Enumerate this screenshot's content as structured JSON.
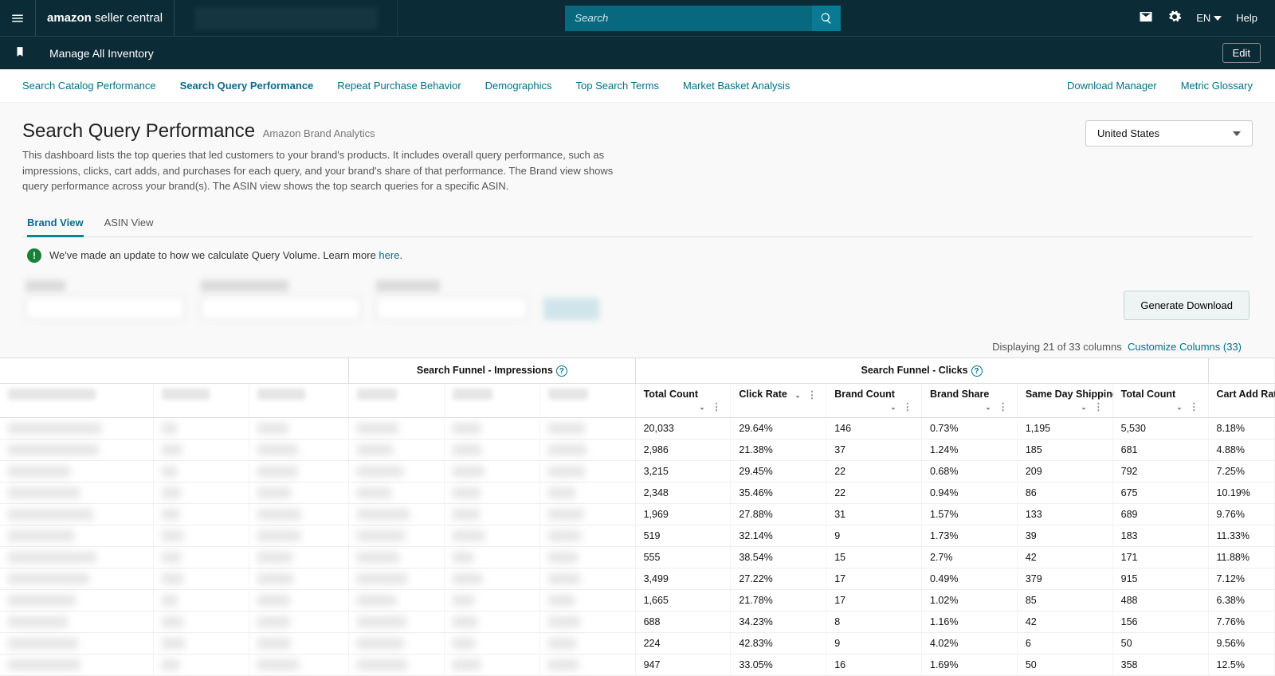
{
  "topbar": {
    "search_placeholder": "Search",
    "lang": "EN",
    "help": "Help"
  },
  "secbar": {
    "title": "Manage All Inventory",
    "edit": "Edit"
  },
  "nav": {
    "items": [
      "Search Catalog Performance",
      "Search Query Performance",
      "Repeat Purchase Behavior",
      "Demographics",
      "Top Search Terms",
      "Market Basket Analysis"
    ],
    "right": [
      "Download Manager",
      "Metric Glossary"
    ]
  },
  "page": {
    "title": "Search Query Performance",
    "subtitle": "Amazon Brand Analytics",
    "description": "This dashboard lists the top queries that led customers to your brand's products. It includes overall query performance, such as impressions, clicks, cart adds, and purchases for each query, and your brand's share of that performance. The Brand view shows query performance across your brand(s). The ASIN view shows the top search queries for a specific ASIN.",
    "country": "United States"
  },
  "viewtabs": {
    "brand": "Brand View",
    "asin": "ASIN View"
  },
  "banner": {
    "text": "We've made an update to how we calculate Query Volume. Learn more ",
    "link": "here"
  },
  "buttons": {
    "genDownload": "Generate Download"
  },
  "colsInfo": {
    "text": "Displaying 21 of 33 columns",
    "link": "Customize Columns (33)"
  },
  "groups": {
    "impressions": "Search Funnel - Impressions",
    "clicks": "Search Funnel - Clicks"
  },
  "headers": {
    "totalCount1": "Total Count",
    "clickRate": "Click Rate",
    "brandCount": "Brand Count",
    "brandShare": "Brand Share",
    "sameDay": "Same Day Shipping Speed",
    "totalCount2": "Total Count",
    "cartRate": "Cart Add Rate"
  },
  "rows": [
    {
      "tc": "20,033",
      "cr": "29.64%",
      "bc": "146",
      "bs": "0.73%",
      "sd": "1,195",
      "tc2": "5,530",
      "car": "8.18%"
    },
    {
      "tc": "2,986",
      "cr": "21.38%",
      "bc": "37",
      "bs": "1.24%",
      "sd": "185",
      "tc2": "681",
      "car": "4.88%"
    },
    {
      "tc": "3,215",
      "cr": "29.45%",
      "bc": "22",
      "bs": "0.68%",
      "sd": "209",
      "tc2": "792",
      "car": "7.25%"
    },
    {
      "tc": "2,348",
      "cr": "35.46%",
      "bc": "22",
      "bs": "0.94%",
      "sd": "86",
      "tc2": "675",
      "car": "10.19%"
    },
    {
      "tc": "1,969",
      "cr": "27.88%",
      "bc": "31",
      "bs": "1.57%",
      "sd": "133",
      "tc2": "689",
      "car": "9.76%"
    },
    {
      "tc": "519",
      "cr": "32.14%",
      "bc": "9",
      "bs": "1.73%",
      "sd": "39",
      "tc2": "183",
      "car": "11.33%"
    },
    {
      "tc": "555",
      "cr": "38.54%",
      "bc": "15",
      "bs": "2.7%",
      "sd": "42",
      "tc2": "171",
      "car": "11.88%"
    },
    {
      "tc": "3,499",
      "cr": "27.22%",
      "bc": "17",
      "bs": "0.49%",
      "sd": "379",
      "tc2": "915",
      "car": "7.12%"
    },
    {
      "tc": "1,665",
      "cr": "21.78%",
      "bc": "17",
      "bs": "1.02%",
      "sd": "85",
      "tc2": "488",
      "car": "6.38%"
    },
    {
      "tc": "688",
      "cr": "34.23%",
      "bc": "8",
      "bs": "1.16%",
      "sd": "42",
      "tc2": "156",
      "car": "7.76%"
    },
    {
      "tc": "224",
      "cr": "42.83%",
      "bc": "9",
      "bs": "4.02%",
      "sd": "6",
      "tc2": "50",
      "car": "9.56%"
    },
    {
      "tc": "947",
      "cr": "33.05%",
      "bc": "16",
      "bs": "1.69%",
      "sd": "50",
      "tc2": "358",
      "car": "12.5%"
    }
  ]
}
